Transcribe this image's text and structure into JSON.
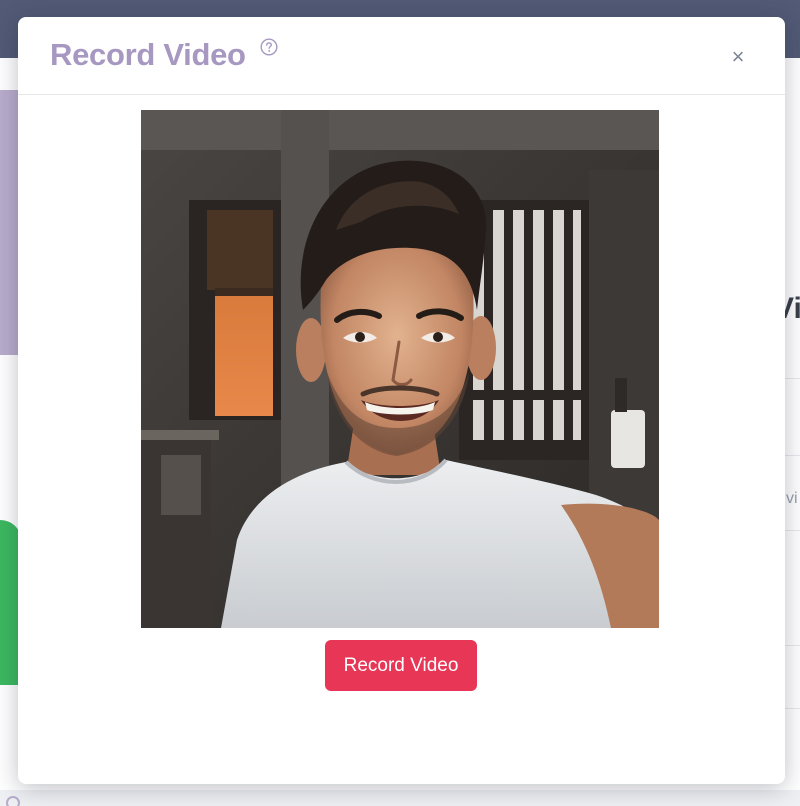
{
  "modal": {
    "title": "Record Video",
    "close_symbol": "×",
    "record_button_label": "Record Video"
  },
  "background": {
    "heading_fragment": "Vi",
    "text_fragment": "vi"
  },
  "icons": {
    "help": "question-circle-icon",
    "close": "close-icon"
  },
  "colors": {
    "topbar": "#3b4463",
    "title": "#a798c2",
    "record_button": "#e73656",
    "accent_purple": "#b0a2c6",
    "accent_green": "#22b04a"
  }
}
